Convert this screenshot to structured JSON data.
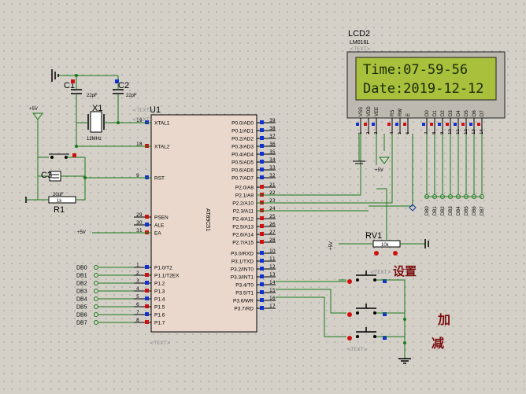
{
  "mcu": {
    "ref": "U1",
    "part": "AT89C51",
    "text_tag": "<TEXT>",
    "left_pins": [
      {
        "name": "XTAL1",
        "num": "19"
      },
      {
        "name": "XTAL2",
        "num": "18"
      },
      {
        "name": "RST",
        "num": "9"
      },
      {
        "name": "PSEN",
        "num": "29"
      },
      {
        "name": "ALE",
        "num": "30"
      },
      {
        "name": "EA",
        "num": "31"
      },
      {
        "name": "P1.0/T2",
        "num": "1"
      },
      {
        "name": "P1.1/T2EX",
        "num": "2"
      },
      {
        "name": "P1.2",
        "num": "3"
      },
      {
        "name": "P1.3",
        "num": "4"
      },
      {
        "name": "P1.4",
        "num": "5"
      },
      {
        "name": "P1.5",
        "num": "6"
      },
      {
        "name": "P1.6",
        "num": "7"
      },
      {
        "name": "P1.7",
        "num": "8"
      }
    ],
    "right_pins": [
      {
        "name": "P0.0/AD0",
        "num": "39"
      },
      {
        "name": "P0.1/AD1",
        "num": "38"
      },
      {
        "name": "P0.2/AD2",
        "num": "37"
      },
      {
        "name": "P0.3/AD3",
        "num": "36"
      },
      {
        "name": "P0.4/AD4",
        "num": "35"
      },
      {
        "name": "P0.5/AD5",
        "num": "34"
      },
      {
        "name": "P0.6/AD6",
        "num": "33"
      },
      {
        "name": "P0.7/AD7",
        "num": "32"
      },
      {
        "name": "P2.0/A8",
        "num": "21"
      },
      {
        "name": "P2.1/A9",
        "num": "22"
      },
      {
        "name": "P2.2/A10",
        "num": "23"
      },
      {
        "name": "P2.3/A11",
        "num": "24"
      },
      {
        "name": "P2.4/A12",
        "num": "25"
      },
      {
        "name": "P2.5/A13",
        "num": "26"
      },
      {
        "name": "P2.6/A14",
        "num": "27"
      },
      {
        "name": "P2.7/A15",
        "num": "28"
      },
      {
        "name": "P3.0/RXD",
        "num": "10"
      },
      {
        "name": "P3.1/TXD",
        "num": "11"
      },
      {
        "name": "P3.2/INT0",
        "num": "12"
      },
      {
        "name": "P3.3/INT1",
        "num": "13"
      },
      {
        "name": "P3.4/T0",
        "num": "14"
      },
      {
        "name": "P3.5/T1",
        "num": "15"
      },
      {
        "name": "P3.6/WR",
        "num": "16"
      },
      {
        "name": "P3.7/RD",
        "num": "17"
      }
    ]
  },
  "lcd": {
    "ref": "LCD2",
    "part": "LM016L",
    "text_tag": "<TEXT>",
    "line1": "Time:07-59-56",
    "line2": "Date:2019-12-12",
    "pins": [
      {
        "name": "VSS",
        "num": "1"
      },
      {
        "name": "VDD",
        "num": "2"
      },
      {
        "name": "VEE",
        "num": "3"
      },
      {
        "name": "RS",
        "num": "4"
      },
      {
        "name": "RW",
        "num": "5"
      },
      {
        "name": "E",
        "num": "6"
      },
      {
        "name": "D0",
        "num": "7"
      },
      {
        "name": "D1",
        "num": "8"
      },
      {
        "name": "D2",
        "num": "9"
      },
      {
        "name": "D3",
        "num": "10"
      },
      {
        "name": "D4",
        "num": "11"
      },
      {
        "name": "D5",
        "num": "12"
      },
      {
        "name": "D6",
        "num": "13"
      },
      {
        "name": "D7",
        "num": "14"
      }
    ],
    "bus_labels": [
      "DB0",
      "DB1",
      "DB2",
      "DB3",
      "DB4",
      "DB5",
      "DB6",
      "DB7"
    ]
  },
  "p1_labels": [
    "DB0",
    "DB1",
    "DB2",
    "DB3",
    "DB4",
    "DB5",
    "DB6",
    "DB7"
  ],
  "components": {
    "c1": {
      "ref": "C1",
      "value": "22pF"
    },
    "c2": {
      "ref": "C2",
      "value": "22pF"
    },
    "c3": {
      "ref": "C3",
      "value": "20uF"
    },
    "x1": {
      "ref": "X1",
      "value": "12MHz",
      "text_tag": "<TEXT>"
    },
    "r1": {
      "ref": "R1",
      "value": "1k"
    },
    "rv1": {
      "ref": "RV1",
      "value": "10k"
    }
  },
  "power": {
    "vcc": "+5V"
  },
  "button_labels": {
    "set": "设置",
    "add": "加",
    "sub": "减"
  },
  "text_tag": "<TEXT>",
  "colors": {
    "lcd_bg": "#a8c03c",
    "chip_body": "#ead8cc",
    "wire": "#1a7a1a",
    "pin_red": "#d01010",
    "pin_blue": "#1030d0"
  }
}
